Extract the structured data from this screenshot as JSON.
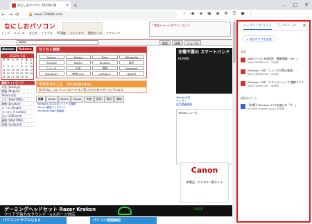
{
  "browser": {
    "tab_title": "なにしおパソコン 2022年3月",
    "url": "www.724685.com",
    "nav_back": "←",
    "nav_forward": "→",
    "nav_reload": "⟳"
  },
  "site": {
    "logo": "なにしおパソコン",
    "logo_sub": "since 2001 724685.com",
    "header_ad": "「完全シャットダウン」という",
    "nav": [
      "トップ",
      "ニュース",
      "まとめ",
      "トラブル",
      "PC設定",
      "ウィンドウ",
      "便利ツール",
      "テクニック"
    ],
    "search_value": "www.",
    "search_buttons": [
      "検索",
      "画像",
      "ニュース"
    ],
    "amazon_label": "Amazon",
    "rakuten_label": "Rakuten",
    "calendar_title": "2022年 4月",
    "calendar_days": [
      "日",
      "月",
      "火",
      "水",
      "木",
      "金",
      "土",
      "",
      "",
      "",
      "",
      "1",
      "2",
      "3",
      "4",
      "5",
      "6",
      "7",
      "8",
      "9",
      "10",
      "11",
      "12",
      "13",
      "14",
      "15",
      "16",
      "17",
      "18",
      "19",
      "20",
      "21",
      "22",
      "23",
      "24",
      "25",
      "26",
      "27",
      "28",
      "29",
      "30"
    ],
    "left_menu_header": "最新サイトピング",
    "left_menu": [
      "天気 (tenki.jp)",
      "地図 (Mapion)",
      "Yahoo!天気",
      "ナビ (NAVITIME)",
      "路線 (Jorudan)",
      "メール (Gmail)",
      "ランキング (video)",
      "占い (AllSmart)",
      "乗換 (NAVITIME)",
      "料理 (cookpad)"
    ],
    "search_box_title": "ちくちく検索",
    "search_links": [
      "Google",
      "Yahoo!",
      "Bing",
      "Wikipedia",
      "YouTube",
      "Twitter",
      "Amazon",
      "楽天",
      "ニュース",
      "天気",
      "地図",
      "Facebook",
      "Instagram",
      "価格.com",
      "AllAbout",
      "NAVER"
    ],
    "today_title": "今日のひとこと",
    "today_date": "2022年4月6日(水)",
    "today_body": "本日もなにしおパソコンのサイトをご覧いただきありがとうございます。",
    "content_tabs": [
      "話題",
      "News",
      "Sports",
      "Social",
      "芸能",
      "経済",
      "政治",
      "趣味"
    ],
    "news_items": [
      "Windows 10 22H2 リリース情報",
      "iPhone 最新アップデート",
      "Microsoft Edge 新機能"
    ],
    "ad_title": "ゲーミングヘッドセット Razer Kraken",
    "ad_sub": "クリアで強力なサウンド・eスポーツ対応",
    "ad_brand": "RAZER",
    "bottom_left": "パソコントラブルＱ＆Ａ",
    "bottom_mid": "パソコン用語解説",
    "smart_ad_t1": "充電不要の スマートバンド",
    "smart_ad_t2": "HUAWEI",
    "right_links": [
      "Yahoo!天気",
      "ウェザー",
      "ほか関連情報"
    ],
    "tw_label": "Yahoo!ニュース",
    "canon_brand": "Canon",
    "canon_text": "新製品・デジタル一眼カメラ"
  },
  "panel": {
    "tab_reading": "リーディングリスト",
    "tab_bookmark": "ブックマーク",
    "close": "✕",
    "add_button": "+ 現在のタブを追加",
    "section_unread": "未読",
    "section_read": "既読のページ",
    "unread_items": [
      {
        "title": "Webページにお使用を「最新情報・Ver...」",
        "src": "www.724685.com · 30分前"
      },
      {
        "title": "Windows 10の「ニュースと関心事項」...",
        "src": "www.724685.com · 30分前"
      },
      {
        "title": "Windows 10の「ドキュメント」で 複数ファイ...",
        "src": "www.724685.com · 30分前"
      }
    ],
    "read_items": [
      {
        "title": "【対策】Windows 11でお使いの「サ...」",
        "src": "pc.watch.impress.co.jp · 30分前"
      }
    ]
  },
  "colors": {
    "accent": "#c33",
    "panel_border": "#e11",
    "link": "#1a73e8"
  }
}
